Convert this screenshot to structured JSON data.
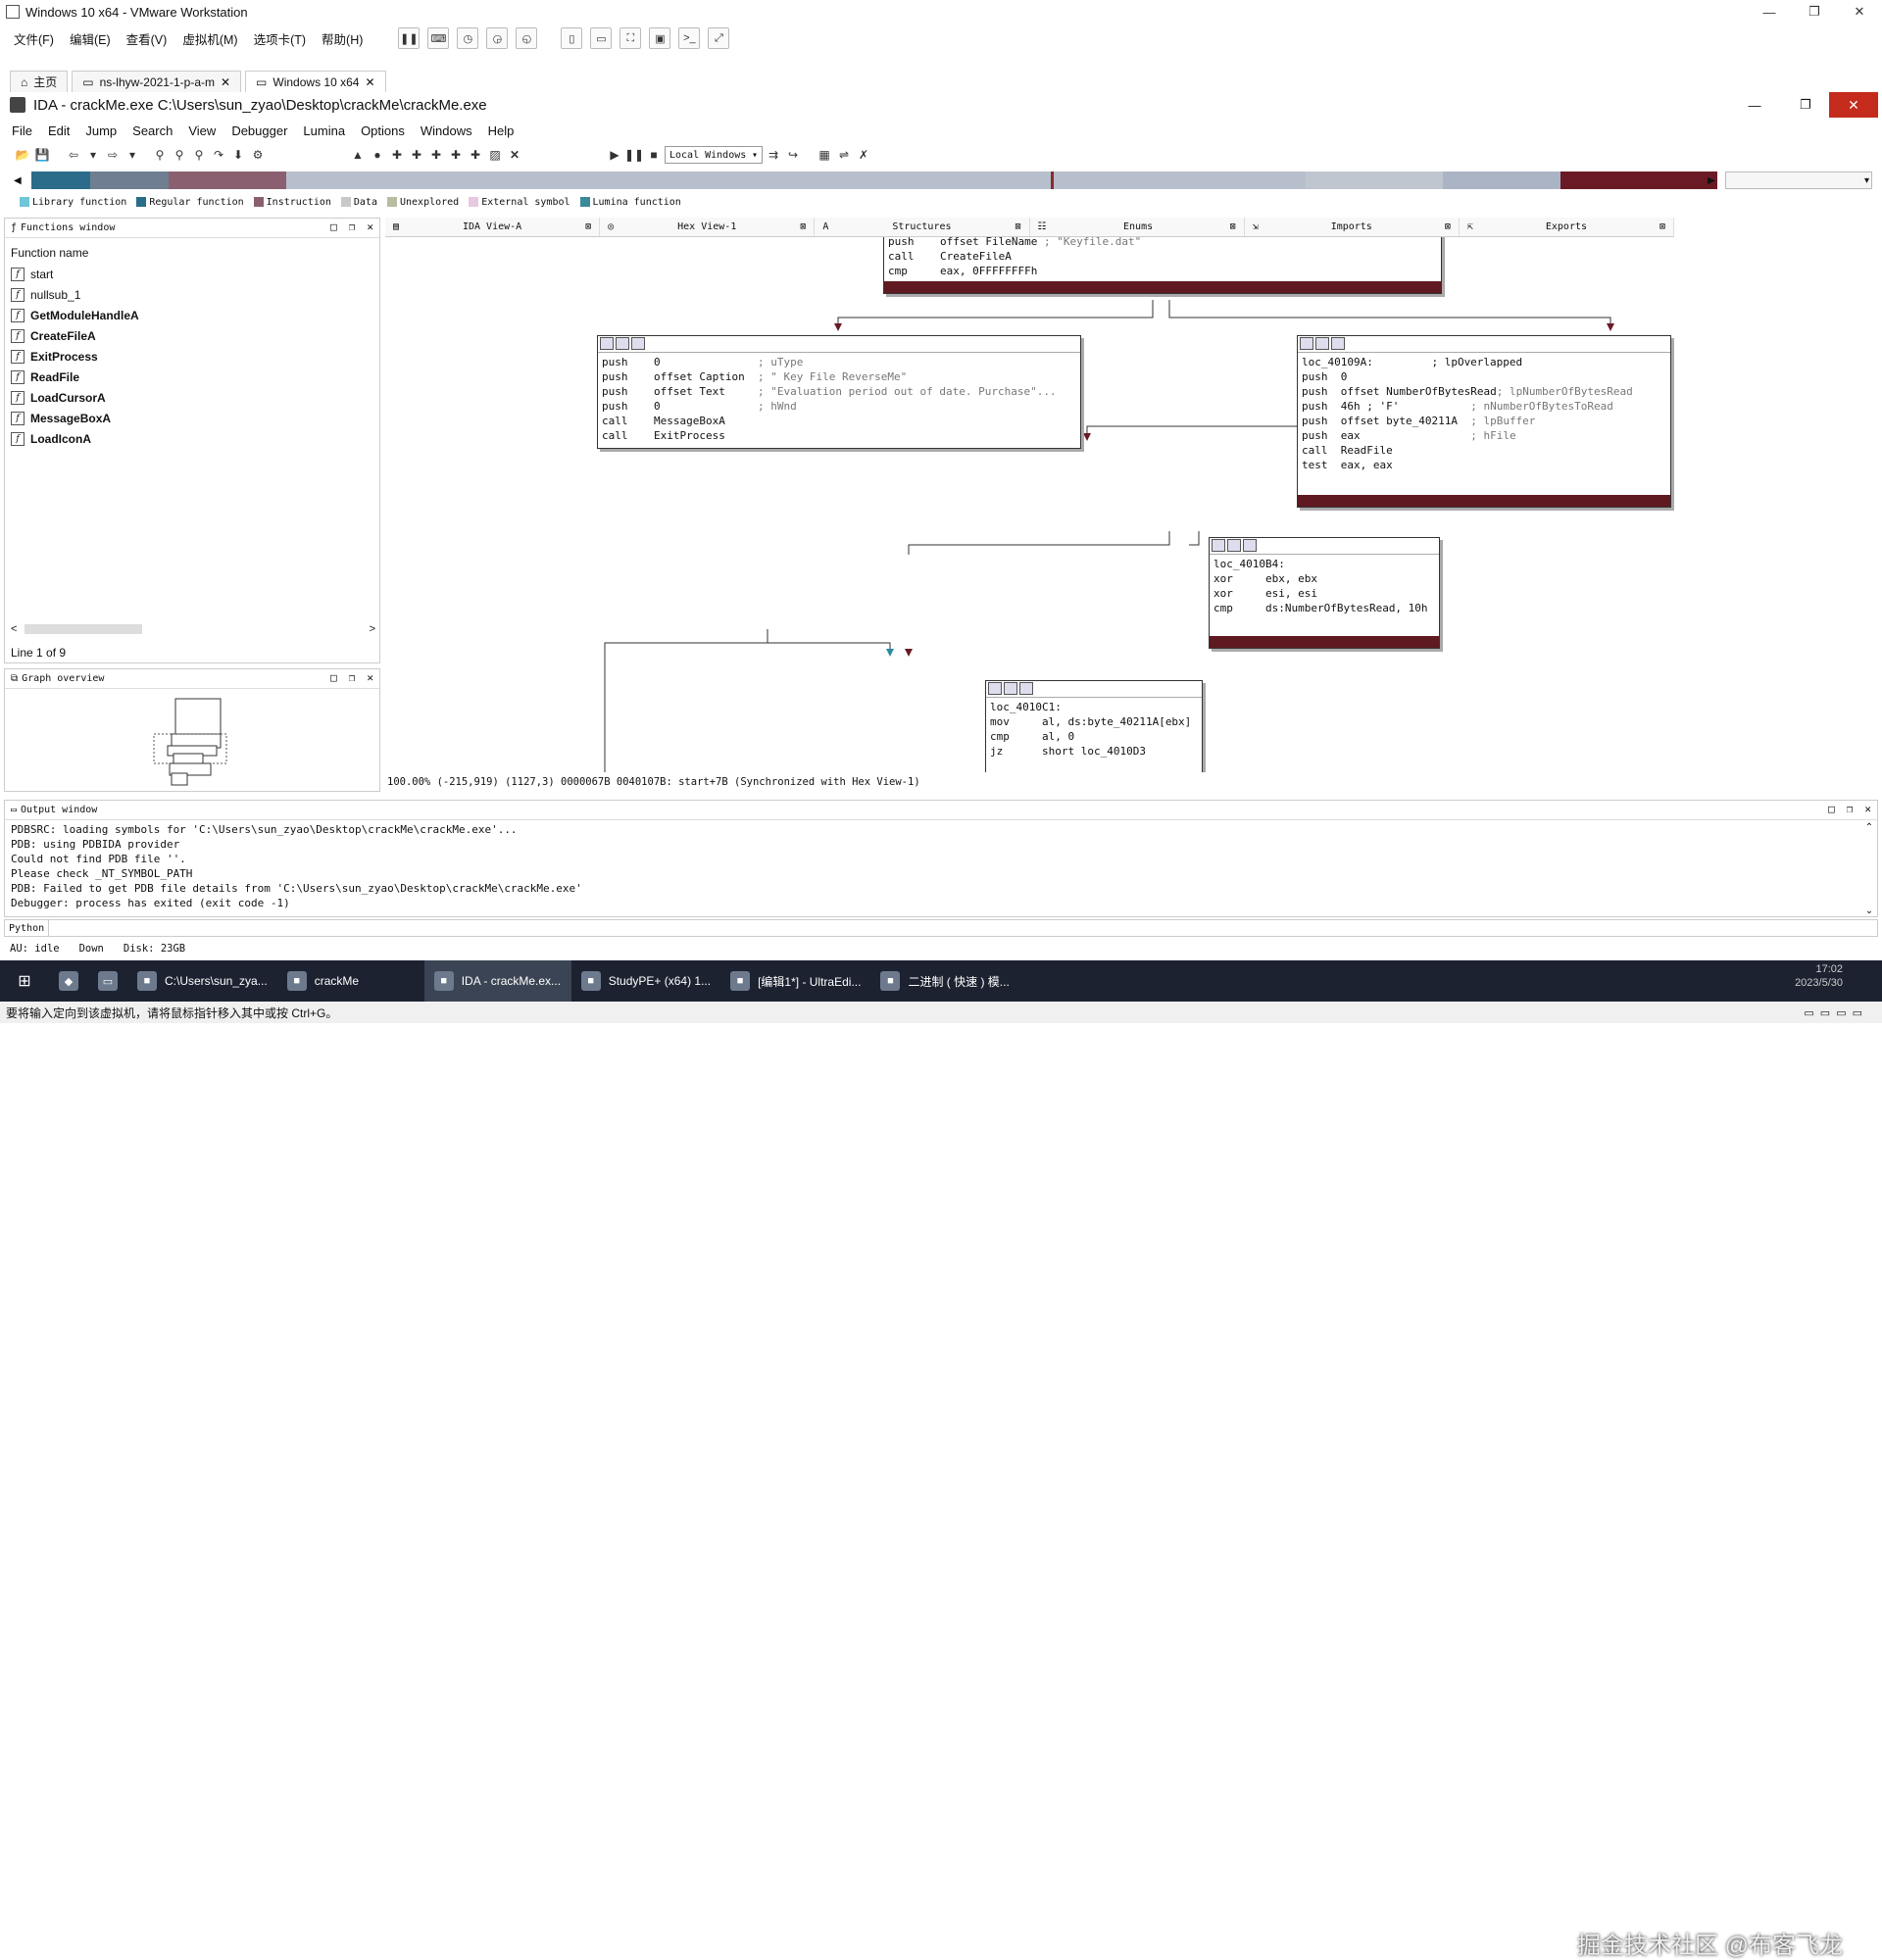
{
  "vmware": {
    "title": "Windows 10 x64 - VMware Workstation",
    "menu": [
      "文件(F)",
      "编辑(E)",
      "查看(V)",
      "虚拟机(M)",
      "选项卡(T)",
      "帮助(H)"
    ],
    "tabs": [
      {
        "label": "主页",
        "icon": "home-icon"
      },
      {
        "label": "ns-lhyw-2021-1-p-a-m",
        "icon": "vm-icon"
      },
      {
        "label": "Windows 10 x64",
        "icon": "vm-icon"
      }
    ],
    "status_message": "要将输入定向到该虚拟机，请将鼠标指针移入其中或按 Ctrl+G。"
  },
  "ida": {
    "title": "IDA - crackMe.exe C:\\Users\\sun_zyao\\Desktop\\crackMe\\crackMe.exe",
    "menu": [
      "File",
      "Edit",
      "Jump",
      "Search",
      "View",
      "Debugger",
      "Lumina",
      "Options",
      "Windows",
      "Help"
    ],
    "debugger_combo": "Local Windows",
    "legend": [
      {
        "label": "Library function",
        "color": "#6ec6d8"
      },
      {
        "label": "Regular function",
        "color": "#2a6c8a"
      },
      {
        "label": "Instruction",
        "color": "#8a6070"
      },
      {
        "label": "Data",
        "color": "#c8c8c8"
      },
      {
        "label": "Unexplored",
        "color": "#b8bca0"
      },
      {
        "label": "External symbol",
        "color": "#e8c8e0"
      },
      {
        "label": "Lumina function",
        "color": "#3a8a9a"
      }
    ],
    "functions_window": {
      "title": "Functions window",
      "column": "Function name",
      "items": [
        "start",
        "nullsub_1",
        "GetModuleHandleA",
        "CreateFileA",
        "ExitProcess",
        "ReadFile",
        "LoadCursorA",
        "MessageBoxA",
        "LoadIconA"
      ],
      "line_info": "Line 1 of 9"
    },
    "graph_overview": {
      "title": "Graph overview"
    },
    "tabs": [
      "IDA View-A",
      "Hex View-1",
      "Structures",
      "Enums",
      "Imports",
      "Exports"
    ],
    "nodes": {
      "top": [
        {
          "op": "push",
          "arg": "offset FileName",
          "cm": "; \"Keyfile.dat\""
        },
        {
          "op": "call",
          "arg": "CreateFileA",
          "cm": ""
        },
        {
          "op": "cmp",
          "arg": "eax, 0FFFFFFFFh",
          "cm": ""
        }
      ],
      "left": [
        {
          "op": "push",
          "arg": "0",
          "cm": "; uType"
        },
        {
          "op": "push",
          "arg": "offset Caption",
          "cm": "; \" Key File ReverseMe\""
        },
        {
          "op": "push",
          "arg": "offset Text",
          "cm": "; \"Evaluation period out of date. Purchase\"..."
        },
        {
          "op": "push",
          "arg": "0",
          "cm": "; hWnd"
        },
        {
          "op": "call",
          "arg": "MessageBoxA",
          "cm": ""
        },
        {
          "op": "call",
          "arg": "ExitProcess",
          "cm": ""
        }
      ],
      "right_label": "loc_40109A:",
      "right_label_cm": "; lpOverlapped",
      "right": [
        {
          "op": "push",
          "arg": "0",
          "cm": ""
        },
        {
          "op": "push",
          "arg": "offset NumberOfBytesRead",
          "cm": "; lpNumberOfBytesRead"
        },
        {
          "op": "push",
          "arg": "46h ; 'F'",
          "cm": "; nNumberOfBytesToRead"
        },
        {
          "op": "push",
          "arg": "offset byte_40211A",
          "cm": "; lpBuffer"
        },
        {
          "op": "push",
          "arg": "eax",
          "cm": "; hFile"
        },
        {
          "op": "call",
          "arg": "ReadFile",
          "cm": ""
        },
        {
          "op": "test",
          "arg": "eax, eax",
          "cm": ""
        }
      ],
      "mid_label": "loc_4010B4:",
      "mid": [
        {
          "op": "xor",
          "arg": "ebx, ebx",
          "cm": ""
        },
        {
          "op": "xor",
          "arg": "esi, esi",
          "cm": ""
        },
        {
          "op": "cmp",
          "arg": "ds:NumberOfBytesRead, 10h",
          "cm": ""
        }
      ],
      "bottom_label": "loc_4010C1:",
      "bottom": [
        {
          "op": "mov",
          "arg": "al, ds:byte_40211A[ebx]",
          "cm": ""
        },
        {
          "op": "cmp",
          "arg": "al, 0",
          "cm": ""
        },
        {
          "op": "jz",
          "arg": "short loc_4010D3",
          "cm": ""
        }
      ]
    },
    "graph_status": "100.00% (-215,919) (1127,3) 0000067B 0040107B: start+7B (Synchronized with Hex View-1)",
    "output": {
      "title": "Output window",
      "lines": [
        "PDBSRC: loading symbols for 'C:\\Users\\sun_zyao\\Desktop\\crackMe\\crackMe.exe'...",
        "PDB: using PDBIDA provider",
        "Could not find PDB file ''.",
        "Please check _NT_SYMBOL_PATH",
        "PDB: Failed to get PDB file details from 'C:\\Users\\sun_zyao\\Desktop\\crackMe\\crackMe.exe'",
        "Debugger: process has exited (exit code -1)"
      ],
      "python_button": "Python"
    },
    "status": {
      "au": "AU:",
      "state": "idle",
      "dir": "Down",
      "disk": "Disk: 23GB"
    }
  },
  "taskbar": {
    "items": [
      {
        "label": "C:\\Users\\sun_zya...",
        "icon": "explorer-icon",
        "active": false
      },
      {
        "label": "crackMe",
        "icon": "folder-icon",
        "active": false
      },
      {
        "label": "IDA - crackMe.ex...",
        "icon": "ida-icon",
        "active": true
      },
      {
        "label": "StudyPE+ (x64) 1...",
        "icon": "studype-icon",
        "active": false
      },
      {
        "label": "[编辑1*] - UltraEdi...",
        "icon": "ultraedit-icon",
        "active": false
      },
      {
        "label": "二进制 ( 快速 ) 模...",
        "icon": "binary-icon",
        "active": false
      }
    ],
    "clock": "17:02",
    "date": "2023/5/30"
  },
  "watermark": "掘金技术社区 @布客飞龙"
}
